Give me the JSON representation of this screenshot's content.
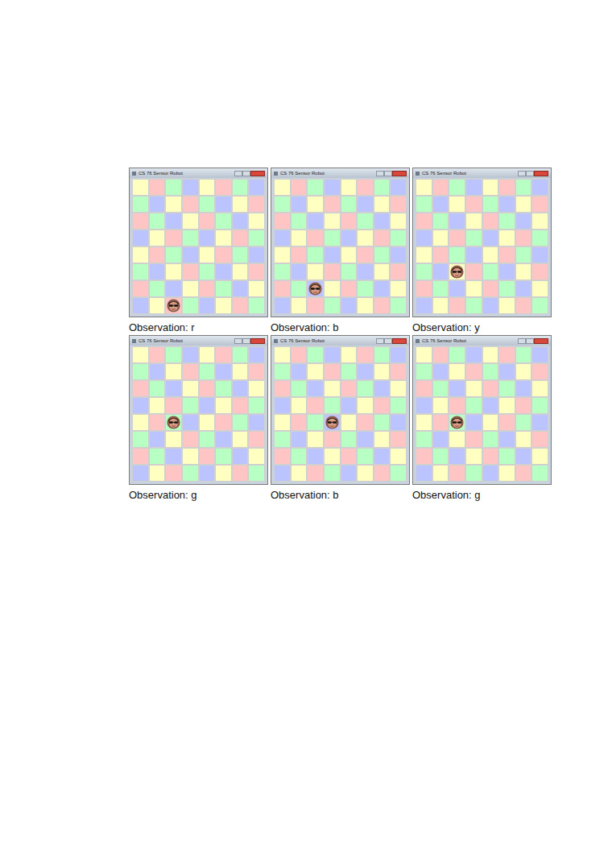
{
  "map": [
    "yrgbyrgb",
    "gbyrgbyr",
    "rgbyrgby",
    "byrgbyrg",
    "yrgbyrgb",
    "gbyrgbyr",
    "rgbyrgby",
    "byrgbyrg"
  ],
  "windows": [
    {
      "title": "CS 76 Sensor Robot",
      "robot": {
        "row": 7,
        "col": 2
      },
      "caption": "Observation: r"
    },
    {
      "title": "CS 76 Sensor Robot",
      "robot": {
        "row": 6,
        "col": 2
      },
      "caption": "Observation: b"
    },
    {
      "title": "CS 76 Sensor Robot",
      "robot": {
        "row": 5,
        "col": 2
      },
      "caption": "Observation: y"
    },
    {
      "title": "CS 76 Sensor Robot",
      "robot": {
        "row": 4,
        "col": 2
      },
      "caption": "Observation: g"
    },
    {
      "title": "CS 76 Sensor Robot",
      "robot": {
        "row": 4,
        "col": 3
      },
      "caption": "Observation: b"
    },
    {
      "title": "CS 76 Sensor Robot",
      "robot": {
        "row": 4,
        "col": 2
      },
      "caption": "Observation: g"
    }
  ]
}
